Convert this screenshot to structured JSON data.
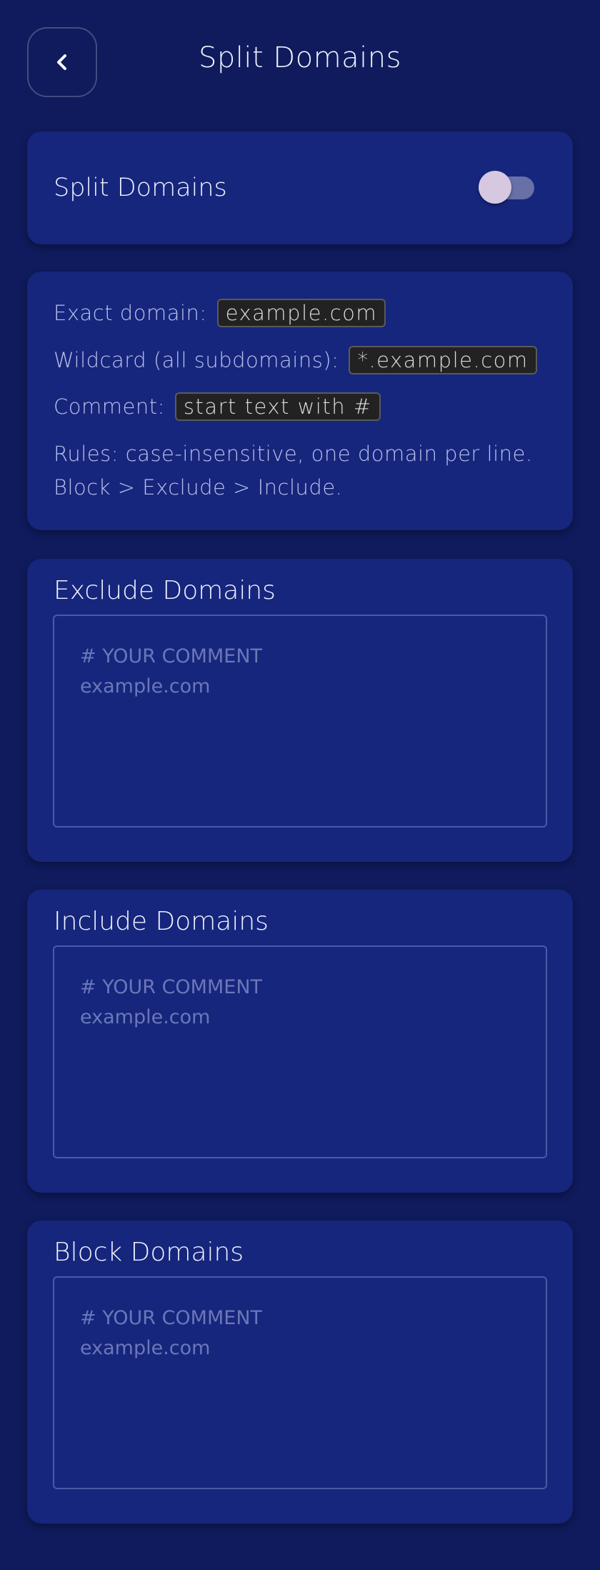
{
  "header": {
    "title": "Split Domains",
    "back_icon": "chevron-left-icon"
  },
  "toggle_card": {
    "label": "Split Domains",
    "enabled": false
  },
  "info": {
    "exact_label": "Exact domain:",
    "exact_code": "example.com",
    "wildcard_label": "Wildcard (all subdomains):",
    "wildcard_code": "*.example.com",
    "comment_label": "Comment:",
    "comment_code": "start text with #",
    "rules_line1": "Rules: case-insensitive, one domain per line.",
    "rules_line2": "Block > Exclude > Include."
  },
  "exclude": {
    "title": "Exclude Domains",
    "placeholder": "# YOUR COMMENT\nexample.com",
    "value": ""
  },
  "include": {
    "title": "Include Domains",
    "placeholder": "# YOUR COMMENT\nexample.com",
    "value": ""
  },
  "block": {
    "title": "Block Domains",
    "placeholder": "# YOUR COMMENT\nexample.com",
    "value": ""
  },
  "colors": {
    "background": "#0f1b5c",
    "card": "#16267d",
    "toggle_track": "#6870a8",
    "toggle_thumb": "#d7c8e2"
  }
}
